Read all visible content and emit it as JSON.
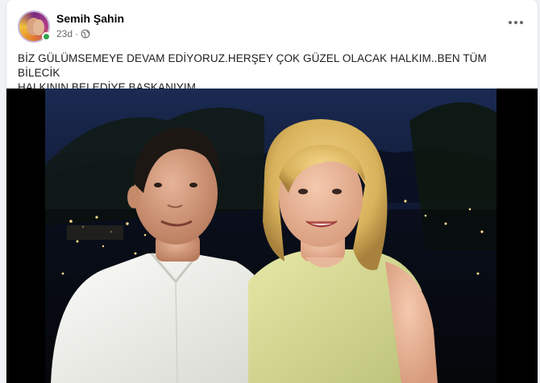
{
  "post": {
    "author_name": "Semih Şahin",
    "timestamp": "23d",
    "audience_icon": "globe-icon",
    "separator": "·",
    "more_icon": "more-horizontal-icon",
    "caption_line1": "BİZ GÜLÜMSEMEYE DEVAM EDİYORUZ.HERŞEY ÇOK GÜZEL OLACAK HALKIM..BEN TÜM BİLECİK",
    "caption_line2": "HALKININ BELEDİYE BAŞKANIYIM..",
    "online_status_color": "#31a24c"
  },
  "colors": {
    "page_bg": "#f0f2f5",
    "card_bg": "#ffffff",
    "primary_text": "#050505",
    "secondary_text": "#65676b"
  }
}
